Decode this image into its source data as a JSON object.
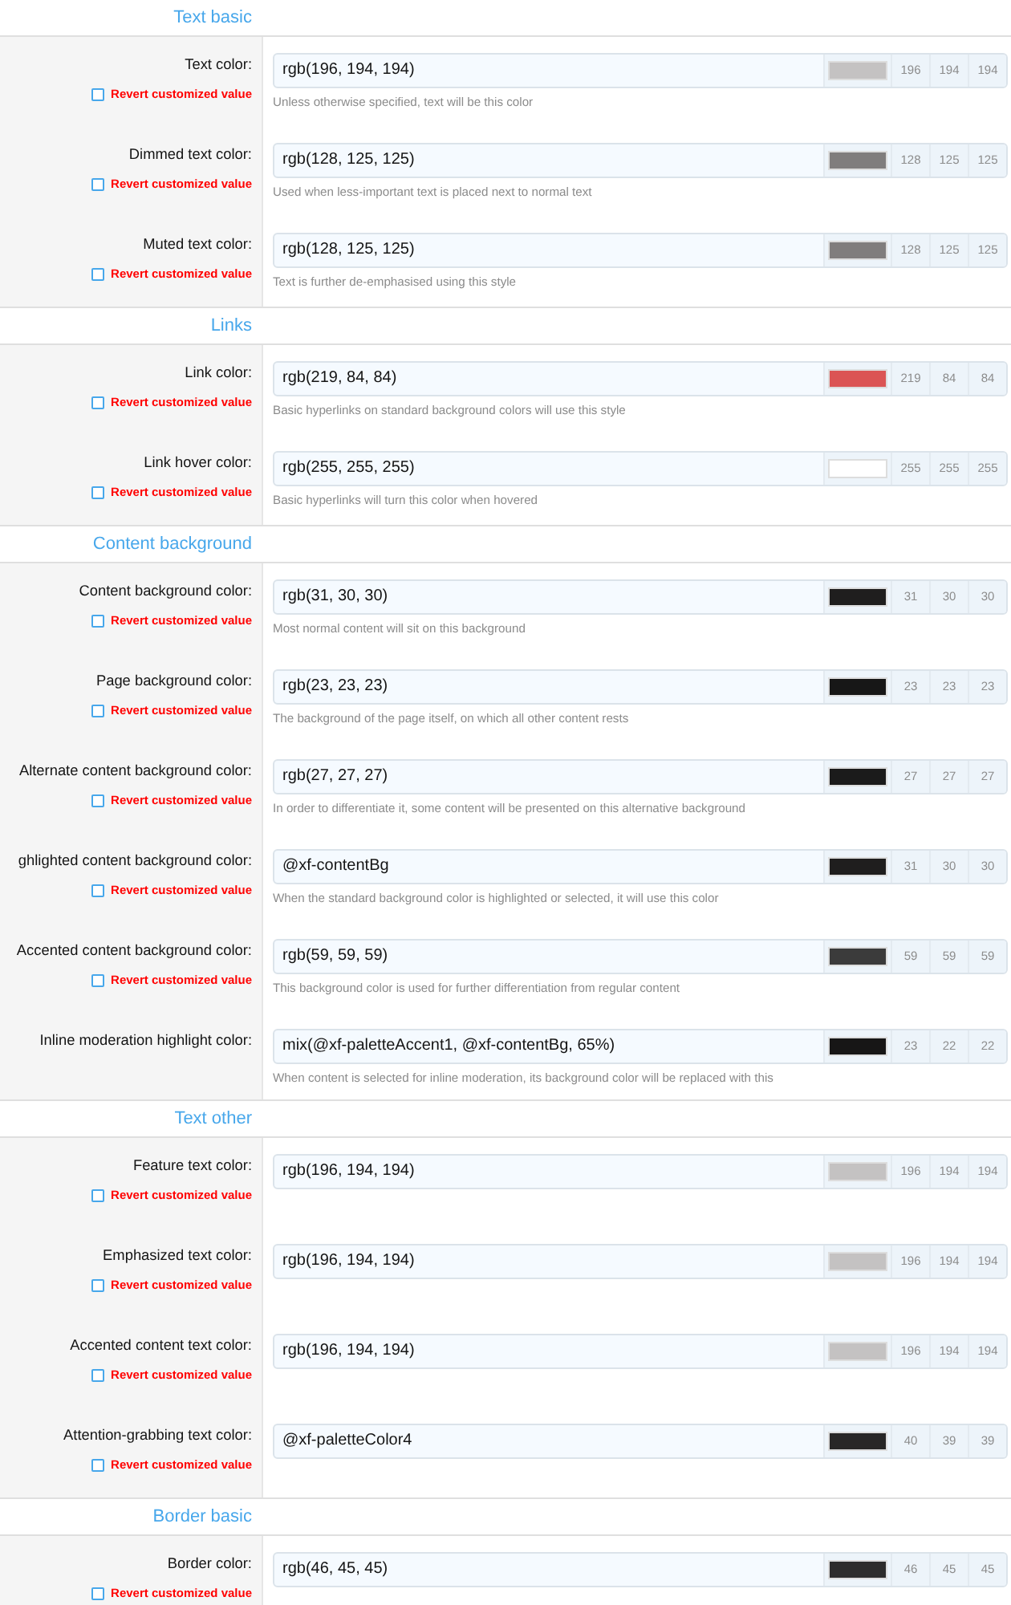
{
  "sections": [
    {
      "title": "Text basic",
      "fields": [
        {
          "label": "Text color:",
          "value": "rgb(196, 194, 194)",
          "color": "#c4c2c2",
          "channels": [
            "196",
            "194",
            "194"
          ],
          "description": "Unless otherwise specified, text will be this color",
          "revert": {
            "label": "Revert customized value",
            "checked": false
          }
        },
        {
          "label": "Dimmed text color:",
          "value": "rgb(128, 125, 125)",
          "color": "#807d7d",
          "channels": [
            "128",
            "125",
            "125"
          ],
          "description": "Used when less-important text is placed next to normal text",
          "revert": {
            "label": "Revert customized value",
            "checked": false
          }
        },
        {
          "label": "Muted text color:",
          "value": "rgb(128, 125, 125)",
          "color": "#807d7d",
          "channels": [
            "128",
            "125",
            "125"
          ],
          "description": "Text is further de-emphasised using this style",
          "revert": {
            "label": "Revert customized value",
            "checked": false
          }
        }
      ]
    },
    {
      "title": "Links",
      "fields": [
        {
          "label": "Link color:",
          "value": "rgb(219, 84, 84)",
          "color": "#db5454",
          "channels": [
            "219",
            "84",
            "84"
          ],
          "description": "Basic hyperlinks on standard background colors will use this style",
          "revert": {
            "label": "Revert customized value",
            "checked": false
          }
        },
        {
          "label": "Link hover color:",
          "value": "rgb(255, 255, 255)",
          "color": "#ffffff",
          "channels": [
            "255",
            "255",
            "255"
          ],
          "description": "Basic hyperlinks will turn this color when hovered",
          "revert": {
            "label": "Revert customized value",
            "checked": false
          }
        }
      ]
    },
    {
      "title": "Content background",
      "fields": [
        {
          "label": "Content background color:",
          "value": "rgb(31, 30, 30)",
          "color": "#1f1e1e",
          "channels": [
            "31",
            "30",
            "30"
          ],
          "description": "Most normal content will sit on this background",
          "revert": {
            "label": "Revert customized value",
            "checked": false
          }
        },
        {
          "label": "Page background color:",
          "value": "rgb(23, 23, 23)",
          "color": "#171717",
          "channels": [
            "23",
            "23",
            "23"
          ],
          "description": "The background of the page itself, on which all other content rests",
          "revert": {
            "label": "Revert customized value",
            "checked": false
          }
        },
        {
          "label": "Alternate content background color:",
          "value": "rgb(27, 27, 27)",
          "color": "#1b1b1b",
          "channels": [
            "27",
            "27",
            "27"
          ],
          "description": "In order to differentiate it, some content will be presented on this alternative background",
          "revert": {
            "label": "Revert customized value",
            "checked": false
          }
        },
        {
          "label": "ghlighted content background color:",
          "value": "@xf-contentBg",
          "color": "#1f1e1e",
          "channels": [
            "31",
            "30",
            "30"
          ],
          "description": "When the standard background color is highlighted or selected, it will use this color",
          "revert": {
            "label": "Revert customized value",
            "checked": false
          }
        },
        {
          "label": "Accented content background color:",
          "value": "rgb(59, 59, 59)",
          "color": "#3b3b3b",
          "channels": [
            "59",
            "59",
            "59"
          ],
          "description": "This background color is used for further differentiation from regular content",
          "revert": {
            "label": "Revert customized value",
            "checked": false
          }
        },
        {
          "label": "Inline moderation highlight color:",
          "value": "mix(@xf-paletteAccent1, @xf-contentBg, 65%)",
          "color": "#171616",
          "channels": [
            "23",
            "22",
            "22"
          ],
          "description": "When content is selected for inline moderation, its background color will be replaced with this"
        }
      ]
    },
    {
      "title": "Text other",
      "fields": [
        {
          "label": "Feature text color:",
          "value": "rgb(196, 194, 194)",
          "color": "#c4c2c2",
          "channels": [
            "196",
            "194",
            "194"
          ],
          "revert": {
            "label": "Revert customized value",
            "checked": false
          }
        },
        {
          "label": "Emphasized text color:",
          "value": "rgb(196, 194, 194)",
          "color": "#c4c2c2",
          "channels": [
            "196",
            "194",
            "194"
          ],
          "revert": {
            "label": "Revert customized value",
            "checked": false
          }
        },
        {
          "label": "Accented content text color:",
          "value": "rgb(196, 194, 194)",
          "color": "#c4c2c2",
          "channels": [
            "196",
            "194",
            "194"
          ],
          "revert": {
            "label": "Revert customized value",
            "checked": false
          }
        },
        {
          "label": "Attention-grabbing text color:",
          "value": "@xf-paletteColor4",
          "color": "#282727",
          "channels": [
            "40",
            "39",
            "39"
          ],
          "revert": {
            "label": "Revert customized value",
            "checked": false
          }
        }
      ]
    },
    {
      "title": "Border basic",
      "fields": [
        {
          "label": "Border color:",
          "value": "rgb(46, 45, 45)",
          "color": "#2e2d2d",
          "channels": [
            "46",
            "45",
            "45"
          ],
          "revert": {
            "label": "Revert customized value",
            "checked": false
          }
        }
      ]
    }
  ]
}
